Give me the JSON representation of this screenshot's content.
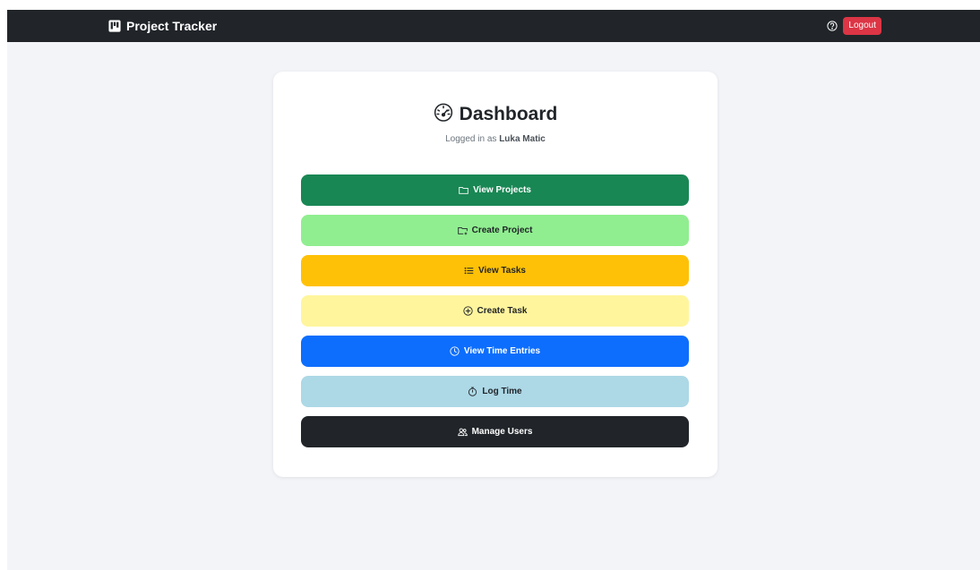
{
  "navbar": {
    "brand_icon": "kanban-icon",
    "brand_title": "Project Tracker",
    "help_icon": "question-circle-icon",
    "logout_label": "Logout"
  },
  "dashboard": {
    "title_icon": "speedometer-icon",
    "title": "Dashboard",
    "logged_in_prefix": "Logged in as",
    "user_name": "Luka Matic",
    "buttons": [
      {
        "label": "View Projects",
        "icon": "folder-icon",
        "bg": "#198754",
        "fg": "#ffffff"
      },
      {
        "label": "Create Project",
        "icon": "folder-plus-icon",
        "bg": "#90ee90",
        "fg": "#212529"
      },
      {
        "label": "View Tasks",
        "icon": "list-icon",
        "bg": "#ffc107",
        "fg": "#212529"
      },
      {
        "label": "Create Task",
        "icon": "plus-circle-icon",
        "bg": "#fff59d",
        "fg": "#212529"
      },
      {
        "label": "View Time Entries",
        "icon": "clock-icon",
        "bg": "#0d6efd",
        "fg": "#ffffff"
      },
      {
        "label": "Log Time",
        "icon": "stopwatch-icon",
        "bg": "#add8e6",
        "fg": "#212529"
      },
      {
        "label": "Manage Users",
        "icon": "people-icon",
        "bg": "#212529",
        "fg": "#ffffff"
      }
    ]
  },
  "colors": {
    "navbar_bg": "#212529",
    "page_bg": "#f3f4f8",
    "logout_bg": "#dc3545"
  }
}
